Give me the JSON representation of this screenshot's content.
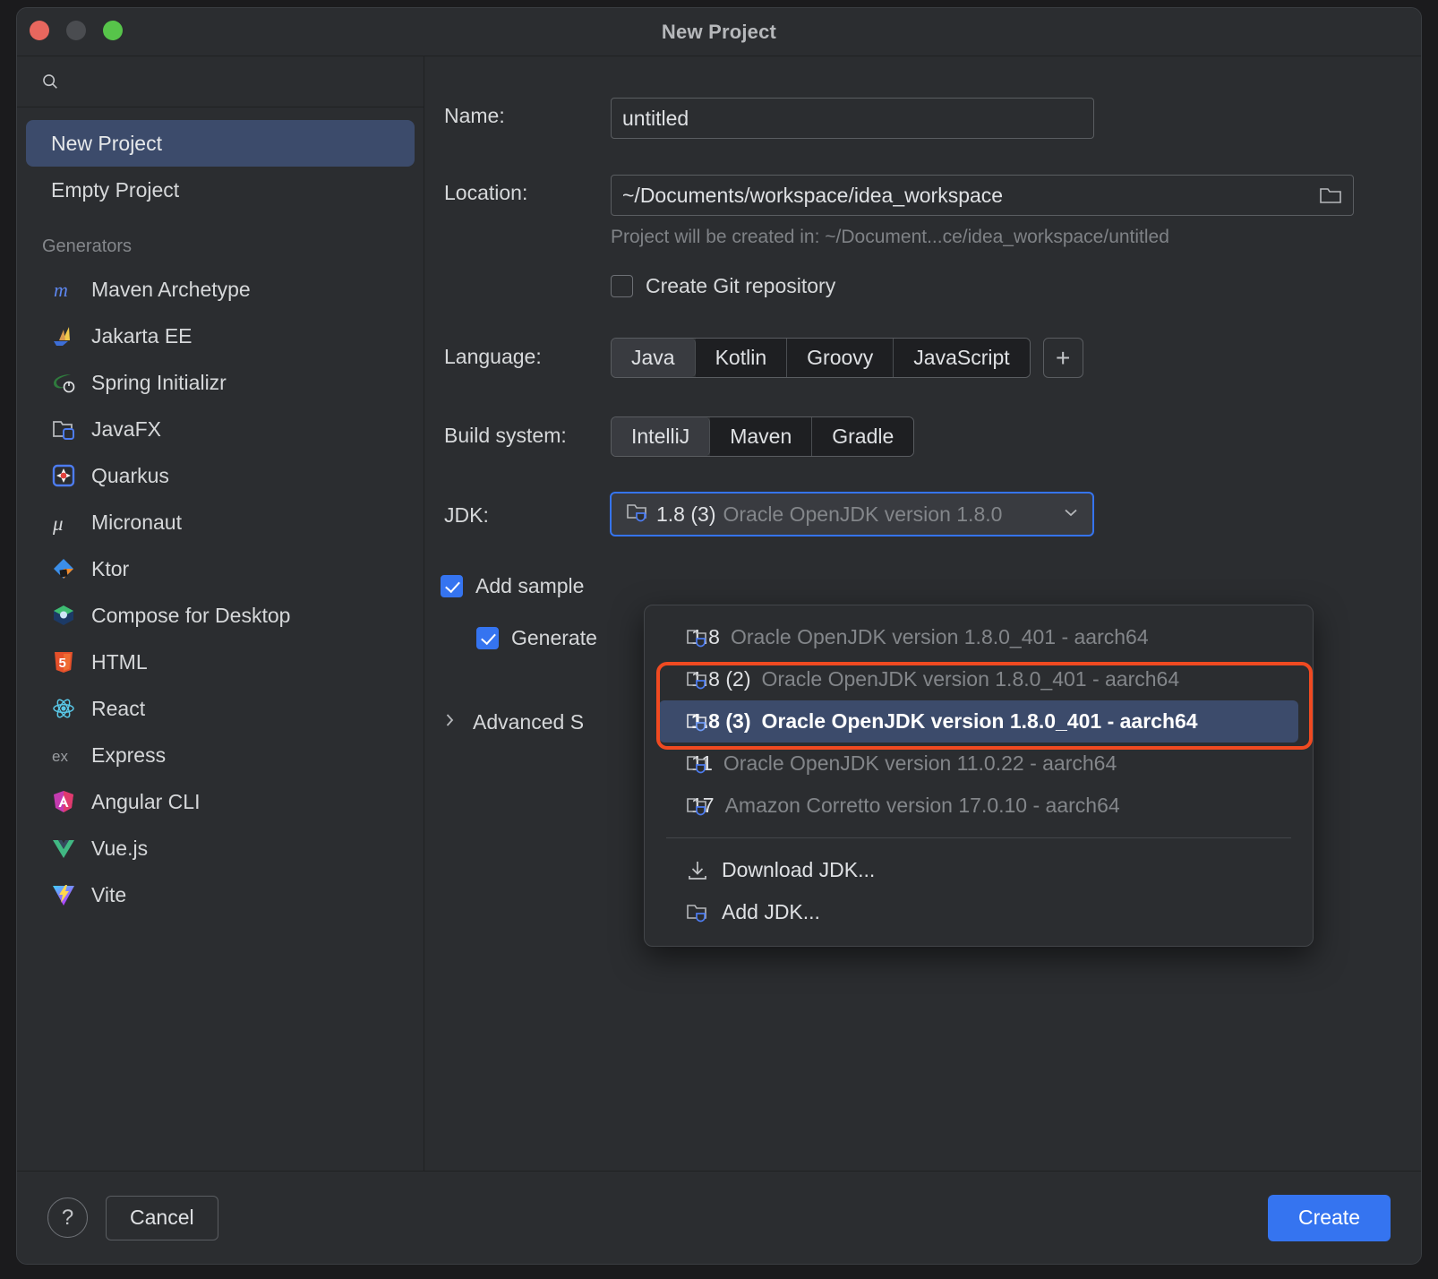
{
  "window": {
    "title": "New Project",
    "traffic_lights": [
      "close-button",
      "minimize-button",
      "maximize-button"
    ]
  },
  "sidebar": {
    "search_placeholder": "",
    "templates": [
      {
        "label": "New Project",
        "selected": true
      },
      {
        "label": "Empty Project",
        "selected": false
      }
    ],
    "generators_heading": "Generators",
    "generators": [
      {
        "label": "Maven Archetype",
        "icon": "maven-icon"
      },
      {
        "label": "Jakarta EE",
        "icon": "jakarta-ee-icon"
      },
      {
        "label": "Spring Initializr",
        "icon": "spring-icon"
      },
      {
        "label": "JavaFX",
        "icon": "javafx-icon"
      },
      {
        "label": "Quarkus",
        "icon": "quarkus-icon"
      },
      {
        "label": "Micronaut",
        "icon": "micronaut-icon"
      },
      {
        "label": "Ktor",
        "icon": "ktor-icon"
      },
      {
        "label": "Compose for Desktop",
        "icon": "compose-icon"
      },
      {
        "label": "HTML",
        "icon": "html5-icon"
      },
      {
        "label": "React",
        "icon": "react-icon"
      },
      {
        "label": "Express",
        "icon": "express-icon"
      },
      {
        "label": "Angular CLI",
        "icon": "angular-icon"
      },
      {
        "label": "Vue.js",
        "icon": "vuejs-icon"
      },
      {
        "label": "Vite",
        "icon": "vite-icon"
      }
    ]
  },
  "form": {
    "name_label": "Name:",
    "name_value": "untitled",
    "location_label": "Location:",
    "location_value": "~/Documents/workspace/idea_workspace",
    "location_browse_icon": "folder-icon",
    "project_path_hint": "Project will be created in: ~/Document...ce/idea_workspace/untitled",
    "git_checkbox_label": "Create Git repository",
    "git_checked": false,
    "language_label": "Language:",
    "languages": [
      "Java",
      "Kotlin",
      "Groovy",
      "JavaScript"
    ],
    "language_selected": "Java",
    "add_language_label": "+",
    "build_system_label": "Build system:",
    "build_systems": [
      "IntelliJ",
      "Maven",
      "Gradle"
    ],
    "build_system_selected": "IntelliJ",
    "jdk_label": "JDK:",
    "jdk_value_name": "1.8 (3)",
    "jdk_value_desc": "Oracle OpenJDK version 1.8.0",
    "add_sample_label": "Add sample",
    "add_sample_checked": true,
    "generate_label": "Generate",
    "generate_checked": true,
    "advanced_settings_label": "Advanced S"
  },
  "jdk_dropdown": {
    "items": [
      {
        "name": "1.8",
        "desc": "Oracle OpenJDK version 1.8.0_401 - aarch64",
        "selected": false
      },
      {
        "name": "1.8 (2)",
        "desc": "Oracle OpenJDK version 1.8.0_401 - aarch64",
        "selected": false
      },
      {
        "name": "1.8 (3)",
        "desc": "Oracle OpenJDK version 1.8.0_401 - aarch64",
        "selected": true
      },
      {
        "name": "11",
        "desc": "Oracle OpenJDK version 11.0.22 - aarch64",
        "selected": false
      },
      {
        "name": "17",
        "desc": "Amazon Corretto version 17.0.10 - aarch64",
        "selected": false
      }
    ],
    "actions": [
      {
        "label": "Download JDK...",
        "icon": "download-icon"
      },
      {
        "label": "Add JDK...",
        "icon": "jdk-folder-icon"
      }
    ]
  },
  "footer": {
    "help_label": "?",
    "cancel_label": "Cancel",
    "create_label": "Create"
  },
  "colors": {
    "accent_blue": "#3574f0",
    "selection_blue": "#3c4b6b",
    "highlight_red": "#f04a21",
    "panel_bg": "#2b2d30",
    "field_bg": "#1e1f22"
  }
}
